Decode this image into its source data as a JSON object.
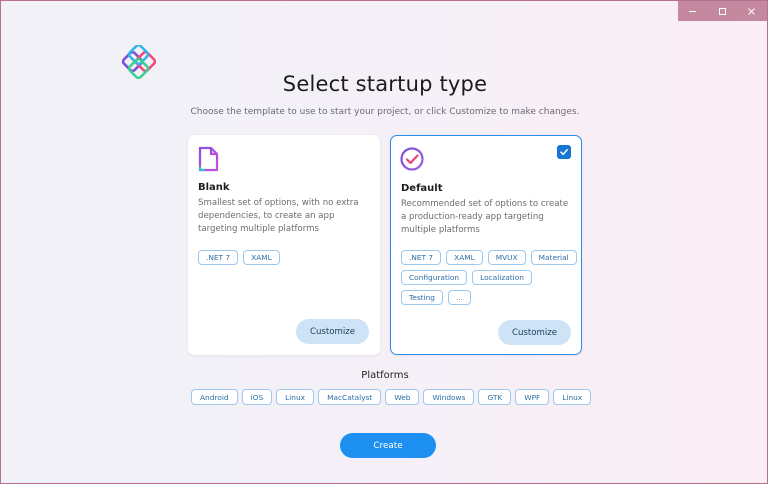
{
  "window": {
    "controls": {
      "minimize_icon": "minimize-icon",
      "maximize_icon": "maximize-icon",
      "close_icon": "close-icon"
    }
  },
  "header": {
    "title": "Select startup type",
    "subtitle": "Choose the template to use to start your project, or click Customize to make changes."
  },
  "cards": [
    {
      "title": "Blank",
      "description": "Smallest set of options, with no extra dependencies, to create an app targeting multiple platforms",
      "tags": [
        ".NET 7",
        "XAML"
      ],
      "customize_label": "Customize",
      "icon": "file-icon",
      "selected": false
    },
    {
      "title": "Default",
      "description": "Recommended set of options to create a production-ready app targeting multiple platforms",
      "tags": [
        ".NET 7",
        "XAML",
        "MVUX",
        "Material",
        "Configuration",
        "Localization",
        "Testing",
        "..."
      ],
      "customize_label": "Customize",
      "icon": "check-circle-icon",
      "selected": true
    }
  ],
  "platforms": {
    "label": "Platforms",
    "items": [
      "Android",
      "iOS",
      "Linux",
      "MacCatalyst",
      "Web",
      "Windows",
      "GTK",
      "WPF",
      "Linux"
    ]
  },
  "footer": {
    "create_label": "Create"
  },
  "colors": {
    "accent": "#1d8ff0",
    "card_selected_border": "#2a8de6",
    "chip_border": "#9ec9ee",
    "chip_text": "#2b6ea8",
    "titlebar_controls": "#c4889f"
  }
}
